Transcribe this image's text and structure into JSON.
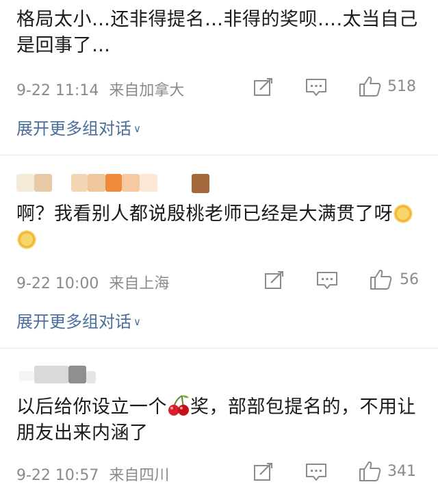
{
  "comments": [
    {
      "text": "格局太小…还非得提名…非得的奖呗….太当自己是回事了…",
      "time": "9-22 11:14",
      "location": "来自加拿大",
      "likes": "518",
      "expand_label": "展开更多组对话"
    },
    {
      "text_a": "啊？我看别人都说殷桃老师已经是大满贯了呀",
      "time": "9-22 10:00",
      "location": "来自上海",
      "likes": "56",
      "expand_label": "展开更多组对话"
    },
    {
      "text_a": "以后给你设立一个",
      "text_b": "奖，部部包提名的，不用让朋友出来内涵了",
      "time": "9-22 10:57",
      "location": "来自四川",
      "likes": "341"
    }
  ],
  "icons": {
    "repost": "repost-icon",
    "comment": "comment-icon",
    "like": "thumbs-up-icon",
    "expand": "chevron-down-icon",
    "emoji_a": "smile-emoji-icon",
    "emoji_b": "cherry-emoji-icon"
  },
  "colors": {
    "link": "#4a6e9c",
    "meta": "#8a8a8a",
    "text": "#1a1a1a"
  }
}
